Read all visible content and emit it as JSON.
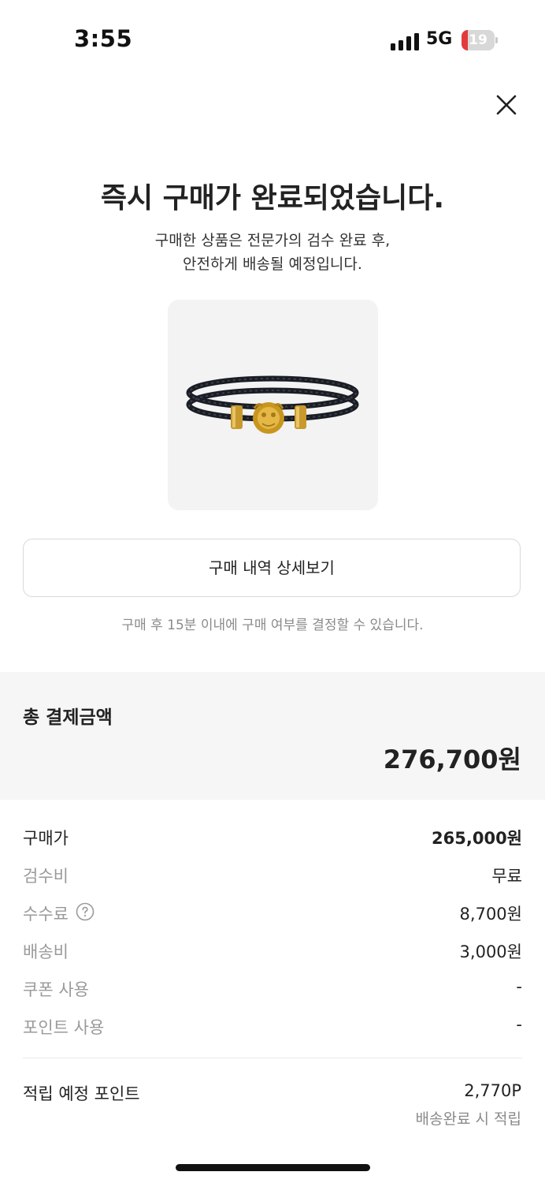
{
  "status_bar": {
    "time": "3:55",
    "network": "5G",
    "battery_level": "19",
    "battery_fraction": 0.19,
    "battery_color": "#e23b3b"
  },
  "header": {
    "close_icon": "close-icon"
  },
  "confirmation": {
    "title": "즉시 구매가 완료되었습니다.",
    "subtitle_line1": "구매한 상품은 전문가의 검수 완료 후,",
    "subtitle_line2": "안전하게 배송될 예정입니다."
  },
  "product": {
    "image_icon": "bracelet-image"
  },
  "actions": {
    "detail_button_label": "구매 내역 상세보기",
    "notice": "구매 후 15분 이내에 구매 여부를 결정할 수 있습니다."
  },
  "total": {
    "label": "총 결제금액",
    "amount": "276,700원"
  },
  "fees": [
    {
      "label": "구매가",
      "value": "265,000원"
    },
    {
      "label": "검수비",
      "value": "무료"
    },
    {
      "label": "수수료",
      "value": "8,700원",
      "icon": "question-circle-icon"
    },
    {
      "label": "배송비",
      "value": "3,000원"
    },
    {
      "label": "쿠폰 사용",
      "value": "-"
    },
    {
      "label": "포인트 사용",
      "value": "-"
    }
  ],
  "points": {
    "label": "적립 예정 포인트",
    "value": "2,770P",
    "note": "배송완료 시 적립"
  }
}
